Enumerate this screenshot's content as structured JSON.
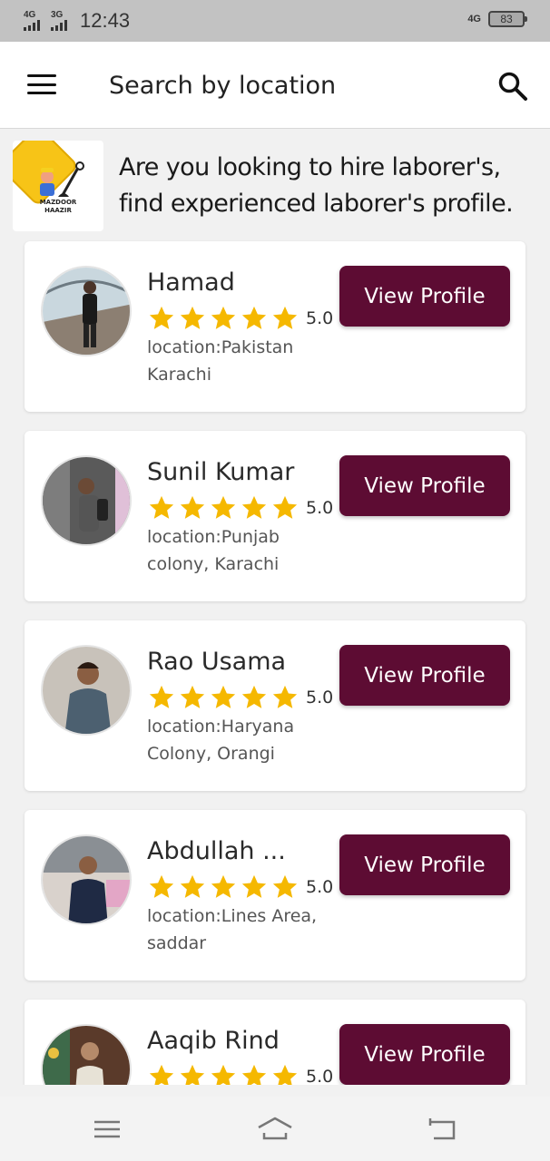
{
  "status_bar": {
    "sim1_label": "4G",
    "sim2_label": "3G",
    "time": "12:43",
    "network": "4G",
    "battery": "83"
  },
  "app_bar": {
    "menu_icon": "hamburger-menu-icon",
    "search_placeholder": "Search by location",
    "search_icon": "search-icon"
  },
  "banner": {
    "logo_text_line1": "MAZDOOR",
    "logo_text_line2": "HAAZIR",
    "text": "Are you looking to hire laborer's, find experienced laborer's profile."
  },
  "colors": {
    "accent": "#5d0c33",
    "star": "#f5b800",
    "logo_yellow": "#f7c417"
  },
  "laborers": [
    {
      "name": "Hamad",
      "rating": "5.0",
      "stars": 5,
      "location": "location:Pakistan Karachi",
      "button": "View Profile"
    },
    {
      "name": "Sunil Kumar",
      "rating": "5.0",
      "stars": 5,
      "location": "location:Punjab colony, Karachi",
      "button": "View Profile"
    },
    {
      "name": "Rao Usama",
      "rating": "5.0",
      "stars": 5,
      "location": "location:Haryana Colony, Orangi",
      "button": "View Profile"
    },
    {
      "name": "Abdullah ...",
      "rating": "5.0",
      "stars": 5,
      "location": "location:Lines Area, saddar",
      "button": "View Profile"
    },
    {
      "name": "Aaqib Rind",
      "rating": "5.0",
      "stars": 5,
      "location": "",
      "button": "View Profile"
    }
  ],
  "nav_bar": {
    "recents_icon": "recent-apps-icon",
    "home_icon": "home-icon",
    "back_icon": "back-icon"
  }
}
